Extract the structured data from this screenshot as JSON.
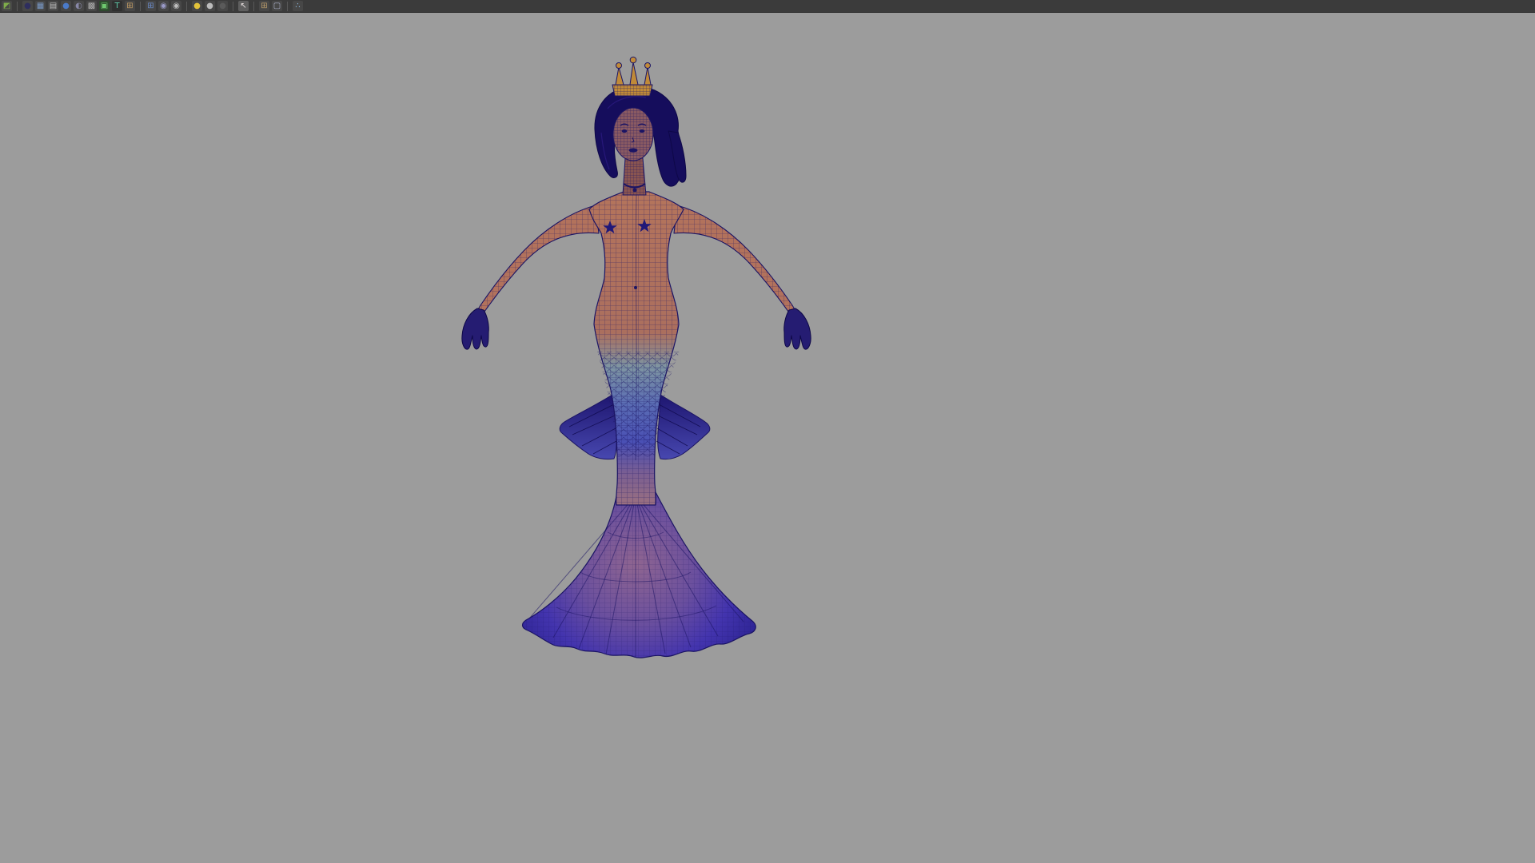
{
  "window": {
    "toolbar_bg": "#3b3b3b",
    "viewport_bg": "#9c9c9c"
  },
  "toolbar": {
    "items": [
      {
        "t": "icon",
        "name": "color-swatch-icon",
        "glyph": "◩",
        "bg": "#474747",
        "color": "#7fae4a"
      },
      {
        "t": "divider"
      },
      {
        "t": "icon",
        "name": "sphere-dark-icon",
        "glyph": "●",
        "bg": "#474747",
        "color": "#2e2e5e"
      },
      {
        "t": "icon",
        "name": "checker-map-icon",
        "glyph": "▦",
        "bg": "#474747",
        "color": "#7a9ac8"
      },
      {
        "t": "icon",
        "name": "grid-table-icon",
        "glyph": "▤",
        "bg": "#474747",
        "color": "#c2c2c2"
      },
      {
        "t": "icon",
        "name": "sphere-blue-icon",
        "glyph": "●",
        "bg": "#474747",
        "color": "#4a7ac8"
      },
      {
        "t": "icon",
        "name": "sphere-shaded-icon",
        "glyph": "◐",
        "bg": "#474747",
        "color": "#8888a8"
      },
      {
        "t": "icon",
        "name": "texture-checker-icon",
        "glyph": "▩",
        "bg": "#474747",
        "color": "#b0b0b0"
      },
      {
        "t": "icon",
        "name": "green-toggle-icon",
        "glyph": "▣",
        "bg": "#2e4a2e",
        "color": "#6ec86e"
      },
      {
        "t": "icon",
        "name": "text-tool-icon",
        "glyph": "T",
        "bg": "#303030",
        "color": "#5ec8a8"
      },
      {
        "t": "icon",
        "name": "cube-icon",
        "glyph": "⊞",
        "bg": "#474747",
        "color": "#c09a62"
      },
      {
        "t": "divider"
      },
      {
        "t": "icon",
        "name": "cube-blue-icon",
        "glyph": "⊞",
        "bg": "#474747",
        "color": "#6a8ac8"
      },
      {
        "t": "icon",
        "name": "sphere-checker-icon",
        "glyph": "◉",
        "bg": "#474747",
        "color": "#9a9ac8"
      },
      {
        "t": "icon",
        "name": "sphere-checker-alt-icon",
        "glyph": "◉",
        "bg": "#474747",
        "color": "#bdbdbd"
      },
      {
        "t": "divider"
      },
      {
        "t": "icon",
        "name": "sphere-yellow-icon",
        "glyph": "●",
        "bg": "#474747",
        "color": "#e2c23a"
      },
      {
        "t": "icon",
        "name": "sphere-gray-icon",
        "glyph": "●",
        "bg": "#474747",
        "color": "#bcbcbc"
      },
      {
        "t": "icon",
        "name": "sphere-dim-icon",
        "glyph": "●",
        "bg": "#474747",
        "color": "#5a5a5a"
      },
      {
        "t": "divider"
      },
      {
        "t": "icon",
        "name": "select-cursor-icon",
        "glyph": "↖",
        "bg": "#5f5f5f",
        "color": "#e8e0e0"
      },
      {
        "t": "divider"
      },
      {
        "t": "icon",
        "name": "cube-tan-icon",
        "glyph": "⊞",
        "bg": "#474747",
        "color": "#b89a6a"
      },
      {
        "t": "icon",
        "name": "cube-outline-icon",
        "glyph": "▢",
        "bg": "#474747",
        "color": "#aab0c8"
      },
      {
        "t": "divider"
      },
      {
        "t": "icon",
        "name": "share-nodes-icon",
        "glyph": "∴",
        "bg": "#474747",
        "color": "#8ab4d8"
      }
    ]
  },
  "viewport": {
    "model": {
      "label": "mermaid-wireframe-model",
      "colors": {
        "wire": "#1b1464",
        "skin": "#b4745c",
        "skin_dark": "#8a5550",
        "hair": "#150d5c",
        "crown_gold": "#c08a38",
        "face": "#8a5a62",
        "hand": "#251c72",
        "fin": "#241b7a",
        "star": "#201878",
        "tail_blue": "#4a50b4",
        "fluke_purple": "#3b2ea6",
        "fluke_pink": "#96688e"
      }
    }
  }
}
